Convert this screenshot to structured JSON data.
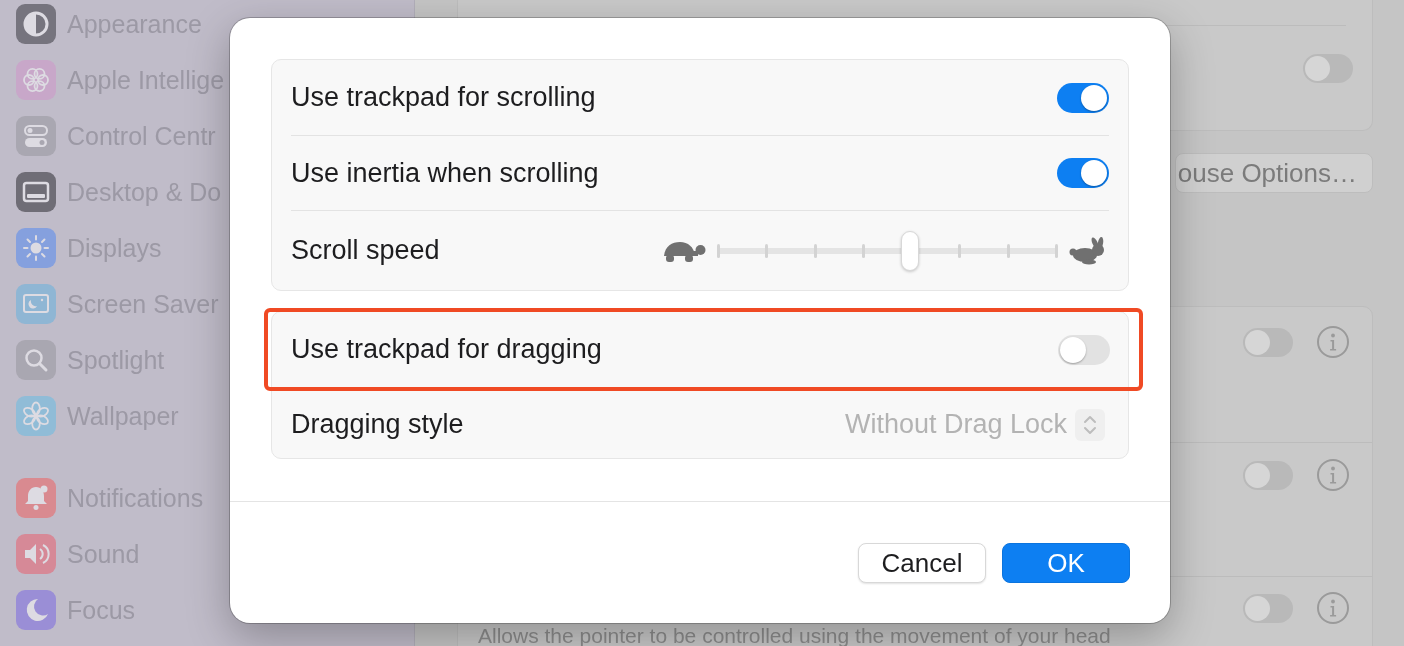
{
  "sidebar": {
    "groups": [
      {
        "items": [
          {
            "label": "Appearance",
            "color": "#76747e"
          },
          {
            "label": "Apple Intellige",
            "color": "#c8a7c9"
          },
          {
            "label": "Control Centr",
            "color": "#a9a7b1"
          },
          {
            "label": "Desktop & Do",
            "color": "#6f6d76"
          },
          {
            "label": "Displays",
            "color": "#85a0de"
          },
          {
            "label": "Screen Saver",
            "color": "#8fb6d4"
          },
          {
            "label": "Spotlight",
            "color": "#a9a7b1"
          },
          {
            "label": "Wallpaper",
            "color": "#90bcd7"
          }
        ]
      },
      {
        "items": [
          {
            "label": "Notifications",
            "color": "#d98a90"
          },
          {
            "label": "Sound",
            "color": "#d68997"
          },
          {
            "label": "Focus",
            "color": "#9a8ed6"
          }
        ]
      }
    ]
  },
  "settings": {
    "top_card": {
      "rows": [
        {
          "on": false
        }
      ]
    },
    "mouse_options_button": "ouse Options…",
    "card": {
      "rows": [
        {
          "on": false
        },
        {
          "on": false
        },
        {
          "on": false,
          "description": "Allows the pointer to be controlled using the movement of your head"
        }
      ]
    }
  },
  "dialog": {
    "groups": [
      {
        "rows": [
          {
            "kind": "toggle",
            "label": "Use trackpad for scrolling",
            "on": true,
            "highlighted": false
          },
          {
            "kind": "toggle",
            "label": "Use inertia when scrolling",
            "on": true,
            "highlighted": false
          },
          {
            "kind": "slider",
            "label": "Scroll speed",
            "level": 0.571,
            "highlighted": false
          }
        ]
      },
      {
        "rows": [
          {
            "kind": "toggle",
            "label": "Use trackpad for dragging",
            "on": false,
            "highlighted": true
          },
          {
            "kind": "popup",
            "label": "Dragging style",
            "value": "Without Drag Lock",
            "disabled": true,
            "highlighted": false
          }
        ]
      }
    ],
    "buttons": [
      {
        "label": "Cancel",
        "kind": "secondary"
      },
      {
        "label": "OK",
        "kind": "primary"
      }
    ]
  }
}
